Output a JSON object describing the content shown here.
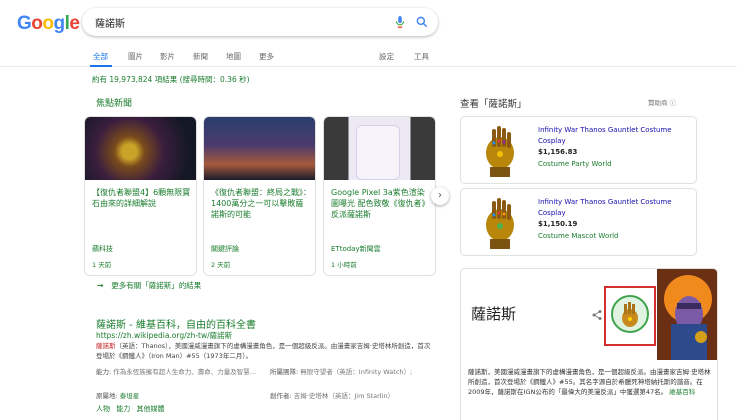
{
  "logo": {
    "text": "Google",
    "colors": [
      "#4285F4",
      "#EA4335",
      "#FBBC05",
      "#4285F4",
      "#34A853",
      "#EA4335"
    ]
  },
  "search": {
    "query": "薩諾斯"
  },
  "tabs": [
    {
      "label": "全部",
      "active": true
    },
    {
      "label": "圖片"
    },
    {
      "label": "影片"
    },
    {
      "label": "新聞"
    },
    {
      "label": "地圖"
    },
    {
      "label": "更多"
    }
  ],
  "tools": {
    "settings": "設定",
    "tools": "工具"
  },
  "stats": "約有 19,973,824 項結果 (搜尋時間：0.36 秒)",
  "news": {
    "section_title": "焦點新聞",
    "cards": [
      {
        "title": "【復仇者聯盟4】6顆無限寶石由來的詳細解說",
        "source": "蘋科技",
        "time": "1 天前"
      },
      {
        "title": "《復仇者聯盟：終局之戰》：1400萬分之一可以擊敗薩諾斯的可能",
        "source": "關鍵評論",
        "time": "2 天前"
      },
      {
        "title": "Google Pixel 3a紫色渲染圖曝光 配色致敬《復仇者》反派薩諾斯",
        "source": "ETtoday新聞雲",
        "time": "1 小時前"
      }
    ],
    "more": "更多有關「薩諾斯」的結果",
    "next_icon": "chevron-right-icon"
  },
  "result": {
    "title": "薩諾斯 - 維基百科，自由的百科全書",
    "url": "https://zh.wikipedia.org/zh-tw/薩諾斯",
    "snippet_hl": "薩諾斯",
    "snippet_rest": "（英語：Thanos），美國漫威漫畫旗下的虛構漫畫角色，是一個超級反派。由漫畫家吉姆·史塔林所創造，首次登場於《鋼鐵人》（Iron Man）#55（1973年二月）。",
    "abilities_label": "能力:",
    "abilities_value": "作為永恆族擁有超人生命力、壽命、力量及智慧...",
    "team_label": "所屬團隊:",
    "team_value": "無限守望者（英語：Infinity Watch）;",
    "species_label": "原屬地:",
    "species_value": "泰坦星",
    "creator_label": "創作者:",
    "creator_value": "吉姆·史塔林（英語：Jim Starlin）",
    "sublinks": [
      "人物",
      "能力",
      "其他媒體"
    ]
  },
  "shopping": {
    "title": "查看「薩諾斯」",
    "sponsored": "贊助商",
    "ads": [
      {
        "name": "Infinity War Thanos Gauntlet Costume Cosplay",
        "price": "$1,156.83",
        "store": "Costume Party World"
      },
      {
        "name": "Infinity War Thanos Gauntlet Costume Cosplay",
        "price": "$1,150.19",
        "store": "Costume Mascot World"
      }
    ]
  },
  "knowledge_panel": {
    "title": "薩諾斯",
    "description": "薩諾斯，美國漫威漫畫旗下的虛構漫畫角色，是一個超級反派。由漫畫家吉姆·史塔林所創造，首次登場於《鋼鐵人》#55。其名字源自於希臘死神塔納托斯的諧音。在2009年，薩諾斯在IGN公布的「最偉大的美漫反派」中獲選第47名。",
    "link": "維基百科"
  },
  "colors": {
    "accent_blue": "#1a73e8",
    "green": "#1a7d2e",
    "red_box": "#d32f2f"
  }
}
